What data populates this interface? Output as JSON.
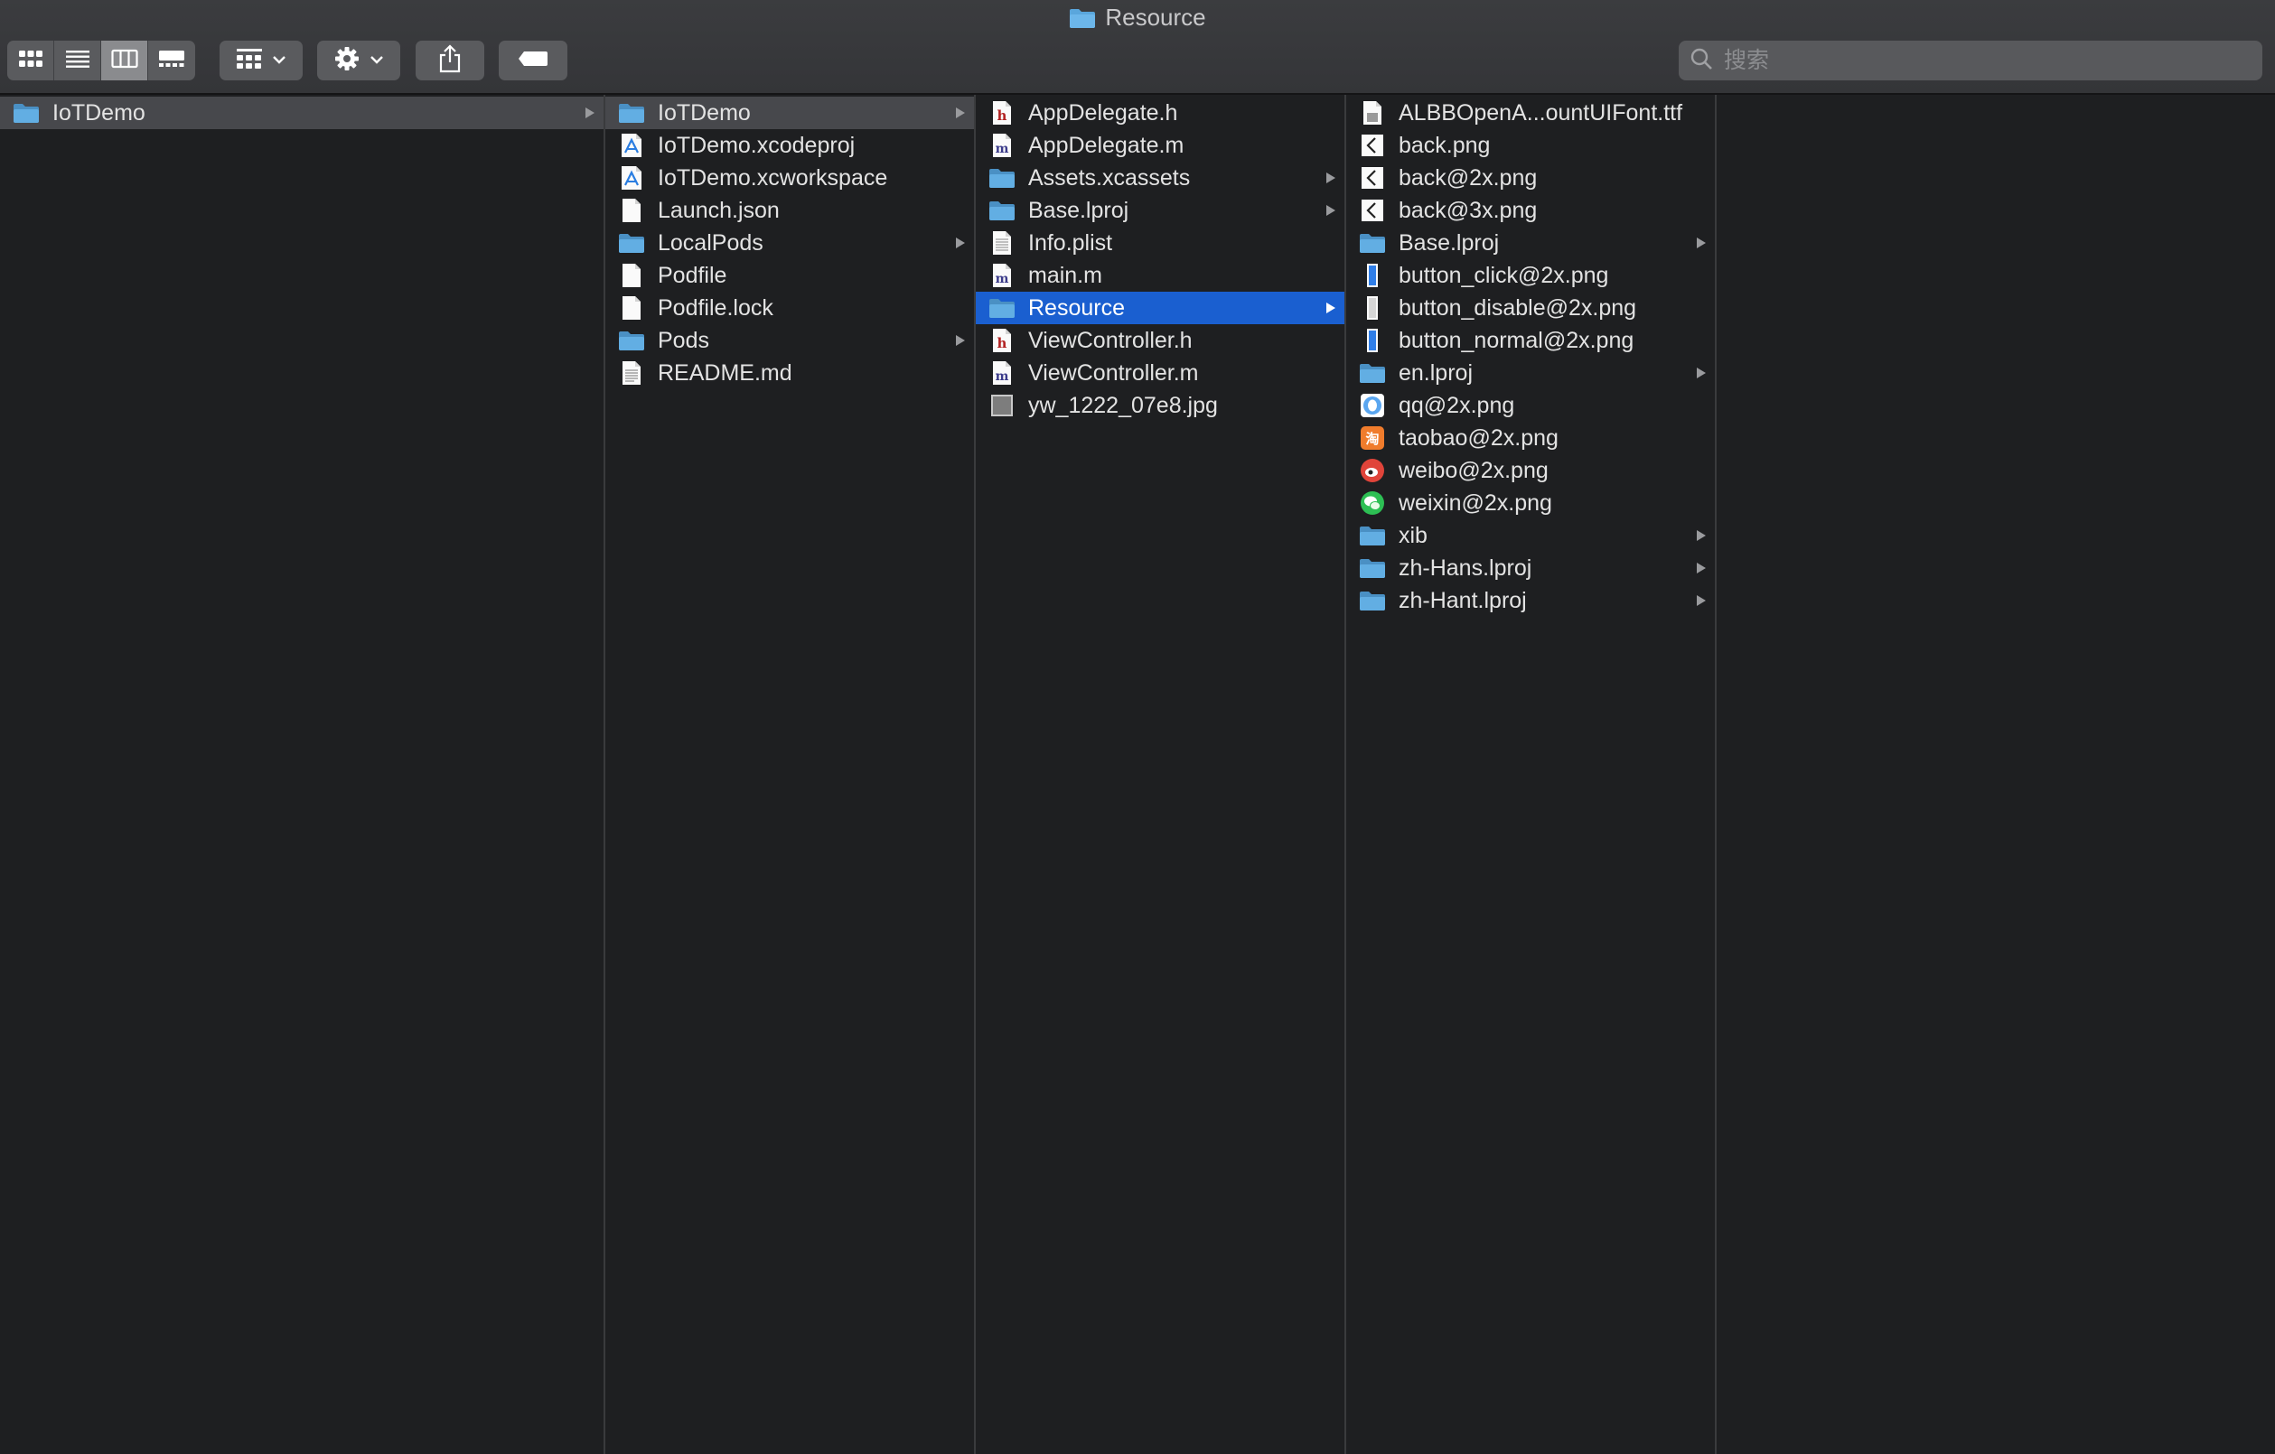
{
  "window": {
    "title": "Resource"
  },
  "toolbar": {
    "view_buttons": [
      "icon-view-icon",
      "list-view-icon",
      "column-view-icon",
      "gallery-view-icon"
    ],
    "active_view": 2
  },
  "search": {
    "placeholder": "搜索",
    "value": ""
  },
  "columns": [
    {
      "items": [
        {
          "name": "IoTDemo",
          "icon": "folder",
          "arrow": true,
          "state": "parent"
        }
      ]
    },
    {
      "items": [
        {
          "name": "IoTDemo",
          "icon": "folder",
          "arrow": true,
          "state": "parent"
        },
        {
          "name": "IoTDemo.xcodeproj",
          "icon": "xcode",
          "arrow": false
        },
        {
          "name": "IoTDemo.xcworkspace",
          "icon": "xcode",
          "arrow": false
        },
        {
          "name": "Launch.json",
          "icon": "doc",
          "arrow": false
        },
        {
          "name": "LocalPods",
          "icon": "folder",
          "arrow": true
        },
        {
          "name": "Podfile",
          "icon": "doc",
          "arrow": false
        },
        {
          "name": "Podfile.lock",
          "icon": "doc",
          "arrow": false
        },
        {
          "name": "Pods",
          "icon": "folder",
          "arrow": true
        },
        {
          "name": "README.md",
          "icon": "text",
          "arrow": false
        }
      ]
    },
    {
      "items": [
        {
          "name": "AppDelegate.h",
          "icon": "h",
          "arrow": false
        },
        {
          "name": "AppDelegate.m",
          "icon": "m",
          "arrow": false
        },
        {
          "name": "Assets.xcassets",
          "icon": "folder",
          "arrow": true
        },
        {
          "name": "Base.lproj",
          "icon": "folder",
          "arrow": true
        },
        {
          "name": "Info.plist",
          "icon": "plist",
          "arrow": false
        },
        {
          "name": "main.m",
          "icon": "m",
          "arrow": false
        },
        {
          "name": "Resource",
          "icon": "folder",
          "arrow": true,
          "state": "selected"
        },
        {
          "name": "ViewController.h",
          "icon": "h",
          "arrow": false
        },
        {
          "name": "ViewController.m",
          "icon": "m",
          "arrow": false
        },
        {
          "name": "yw_1222_07e8.jpg",
          "icon": "jpg",
          "arrow": false
        }
      ]
    },
    {
      "items": [
        {
          "name": "ALBBOpenA...ountUIFont.ttf",
          "icon": "font",
          "arrow": false
        },
        {
          "name": "back.png",
          "icon": "back",
          "arrow": false
        },
        {
          "name": "back@2x.png",
          "icon": "back",
          "arrow": false
        },
        {
          "name": "back@3x.png",
          "icon": "back",
          "arrow": false
        },
        {
          "name": "Base.lproj",
          "icon": "folder",
          "arrow": true
        },
        {
          "name": "button_click@2x.png",
          "icon": "btn-blue",
          "arrow": false
        },
        {
          "name": "button_disable@2x.png",
          "icon": "btn-gray",
          "arrow": false
        },
        {
          "name": "button_normal@2x.png",
          "icon": "btn-blue",
          "arrow": false
        },
        {
          "name": "en.lproj",
          "icon": "folder",
          "arrow": true
        },
        {
          "name": "qq@2x.png",
          "icon": "qq",
          "arrow": false
        },
        {
          "name": "taobao@2x.png",
          "icon": "taobao",
          "arrow": false
        },
        {
          "name": "weibo@2x.png",
          "icon": "weibo",
          "arrow": false
        },
        {
          "name": "weixin@2x.png",
          "icon": "weixin",
          "arrow": false
        },
        {
          "name": "xib",
          "icon": "folder",
          "arrow": true
        },
        {
          "name": "zh-Hans.lproj",
          "icon": "folder",
          "arrow": true
        },
        {
          "name": "zh-Hant.lproj",
          "icon": "folder",
          "arrow": true
        }
      ]
    },
    {
      "items": []
    }
  ],
  "colors": {
    "accent": "#1a5fd0",
    "folder": "#5aa6dc",
    "parent_highlight": "#47484c",
    "background": "#1e1f21"
  }
}
